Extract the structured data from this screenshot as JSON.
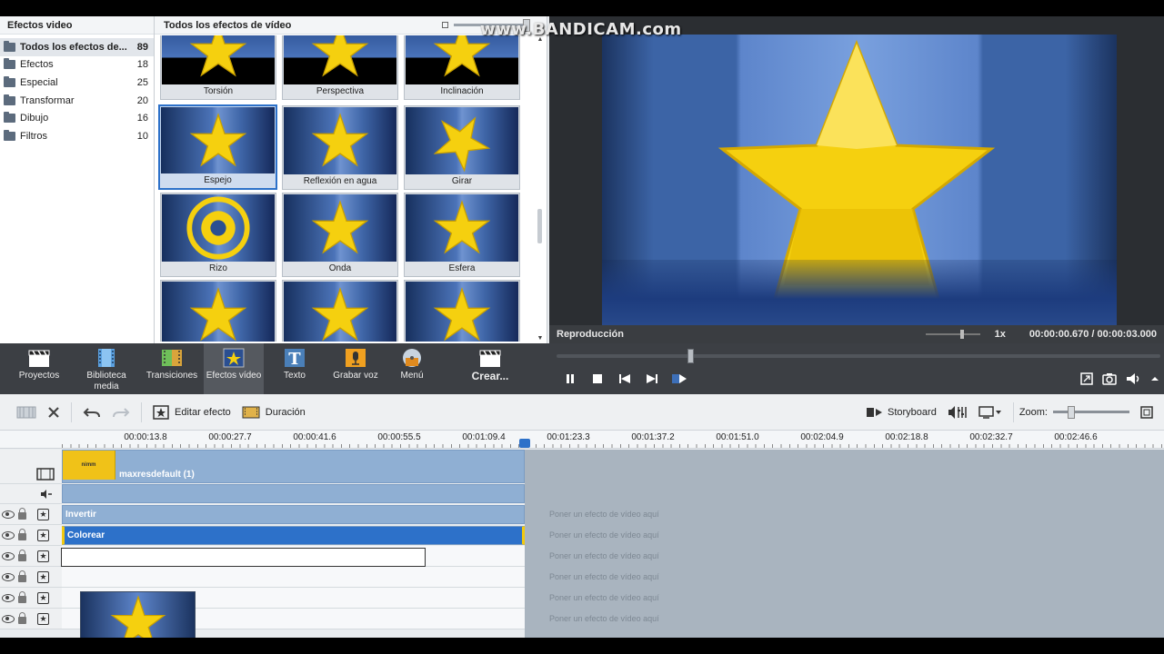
{
  "watermark": "www.BANDICAM.com",
  "categories": {
    "title": "Efectos video",
    "items": [
      {
        "label": "Todos los efectos de...",
        "count": "89"
      },
      {
        "label": "Efectos",
        "count": "18"
      },
      {
        "label": "Especial",
        "count": "25"
      },
      {
        "label": "Transformar",
        "count": "20"
      },
      {
        "label": "Dibujo",
        "count": "16"
      },
      {
        "label": "Filtros",
        "count": "10"
      }
    ]
  },
  "effects": {
    "title": "Todos los efectos de vídeo",
    "tiles": [
      {
        "label": "Torsión"
      },
      {
        "label": "Perspectiva"
      },
      {
        "label": "Inclinación"
      },
      {
        "label": "Espejo"
      },
      {
        "label": "Reflexión en agua"
      },
      {
        "label": "Girar"
      },
      {
        "label": "Rizo"
      },
      {
        "label": "Onda"
      },
      {
        "label": "Esfera"
      },
      {
        "label": ""
      },
      {
        "label": ""
      },
      {
        "label": ""
      }
    ]
  },
  "preview": {
    "label": "Reproducción",
    "speed": "1x",
    "current_time": "00:00:00.670",
    "separator": "/",
    "total_time": "00:00:03.000"
  },
  "toolbar": {
    "items": [
      {
        "label": "Proyectos",
        "icon": "clapper-icon"
      },
      {
        "label": "Biblioteca media",
        "icon": "film-icon"
      },
      {
        "label": "Transiciones",
        "icon": "transitions-icon"
      },
      {
        "label": "Efectos vídeo",
        "icon": "star-effect-icon"
      },
      {
        "label": "Texto",
        "icon": "text-icon"
      },
      {
        "label": "Grabar voz",
        "icon": "microphone-icon"
      },
      {
        "label": "Menú",
        "icon": "disc-menu-icon"
      },
      {
        "label": "Crear...",
        "icon": "create-clapper-icon"
      }
    ]
  },
  "timeline_toolbar": {
    "edit_effect": "Editar efecto",
    "duration": "Duración",
    "storyboard": "Storyboard",
    "zoom_label": "Zoom:"
  },
  "ruler": {
    "ticks": [
      "00:00:13.8",
      "00:00:27.7",
      "00:00:41.6",
      "00:00:55.5",
      "00:01:09.4",
      "00:01:23.3",
      "00:01:37.2",
      "00:01:51.0",
      "00:02:04.9",
      "00:02:18.8",
      "00:02:32.7",
      "00:02:46.6"
    ]
  },
  "tracks": {
    "video_clip_label": "maxresdefault (1)",
    "video_thumb_text": "nimm",
    "clip_invertir": "Invertir",
    "clip_colorear": "Colorear",
    "drop_hint": "Poner un efecto de vídeo aquí"
  },
  "colors": {
    "accent_blue": "#2d71c9",
    "star_yellow": "#f5d00f",
    "dark_band": "#3c3f44"
  }
}
